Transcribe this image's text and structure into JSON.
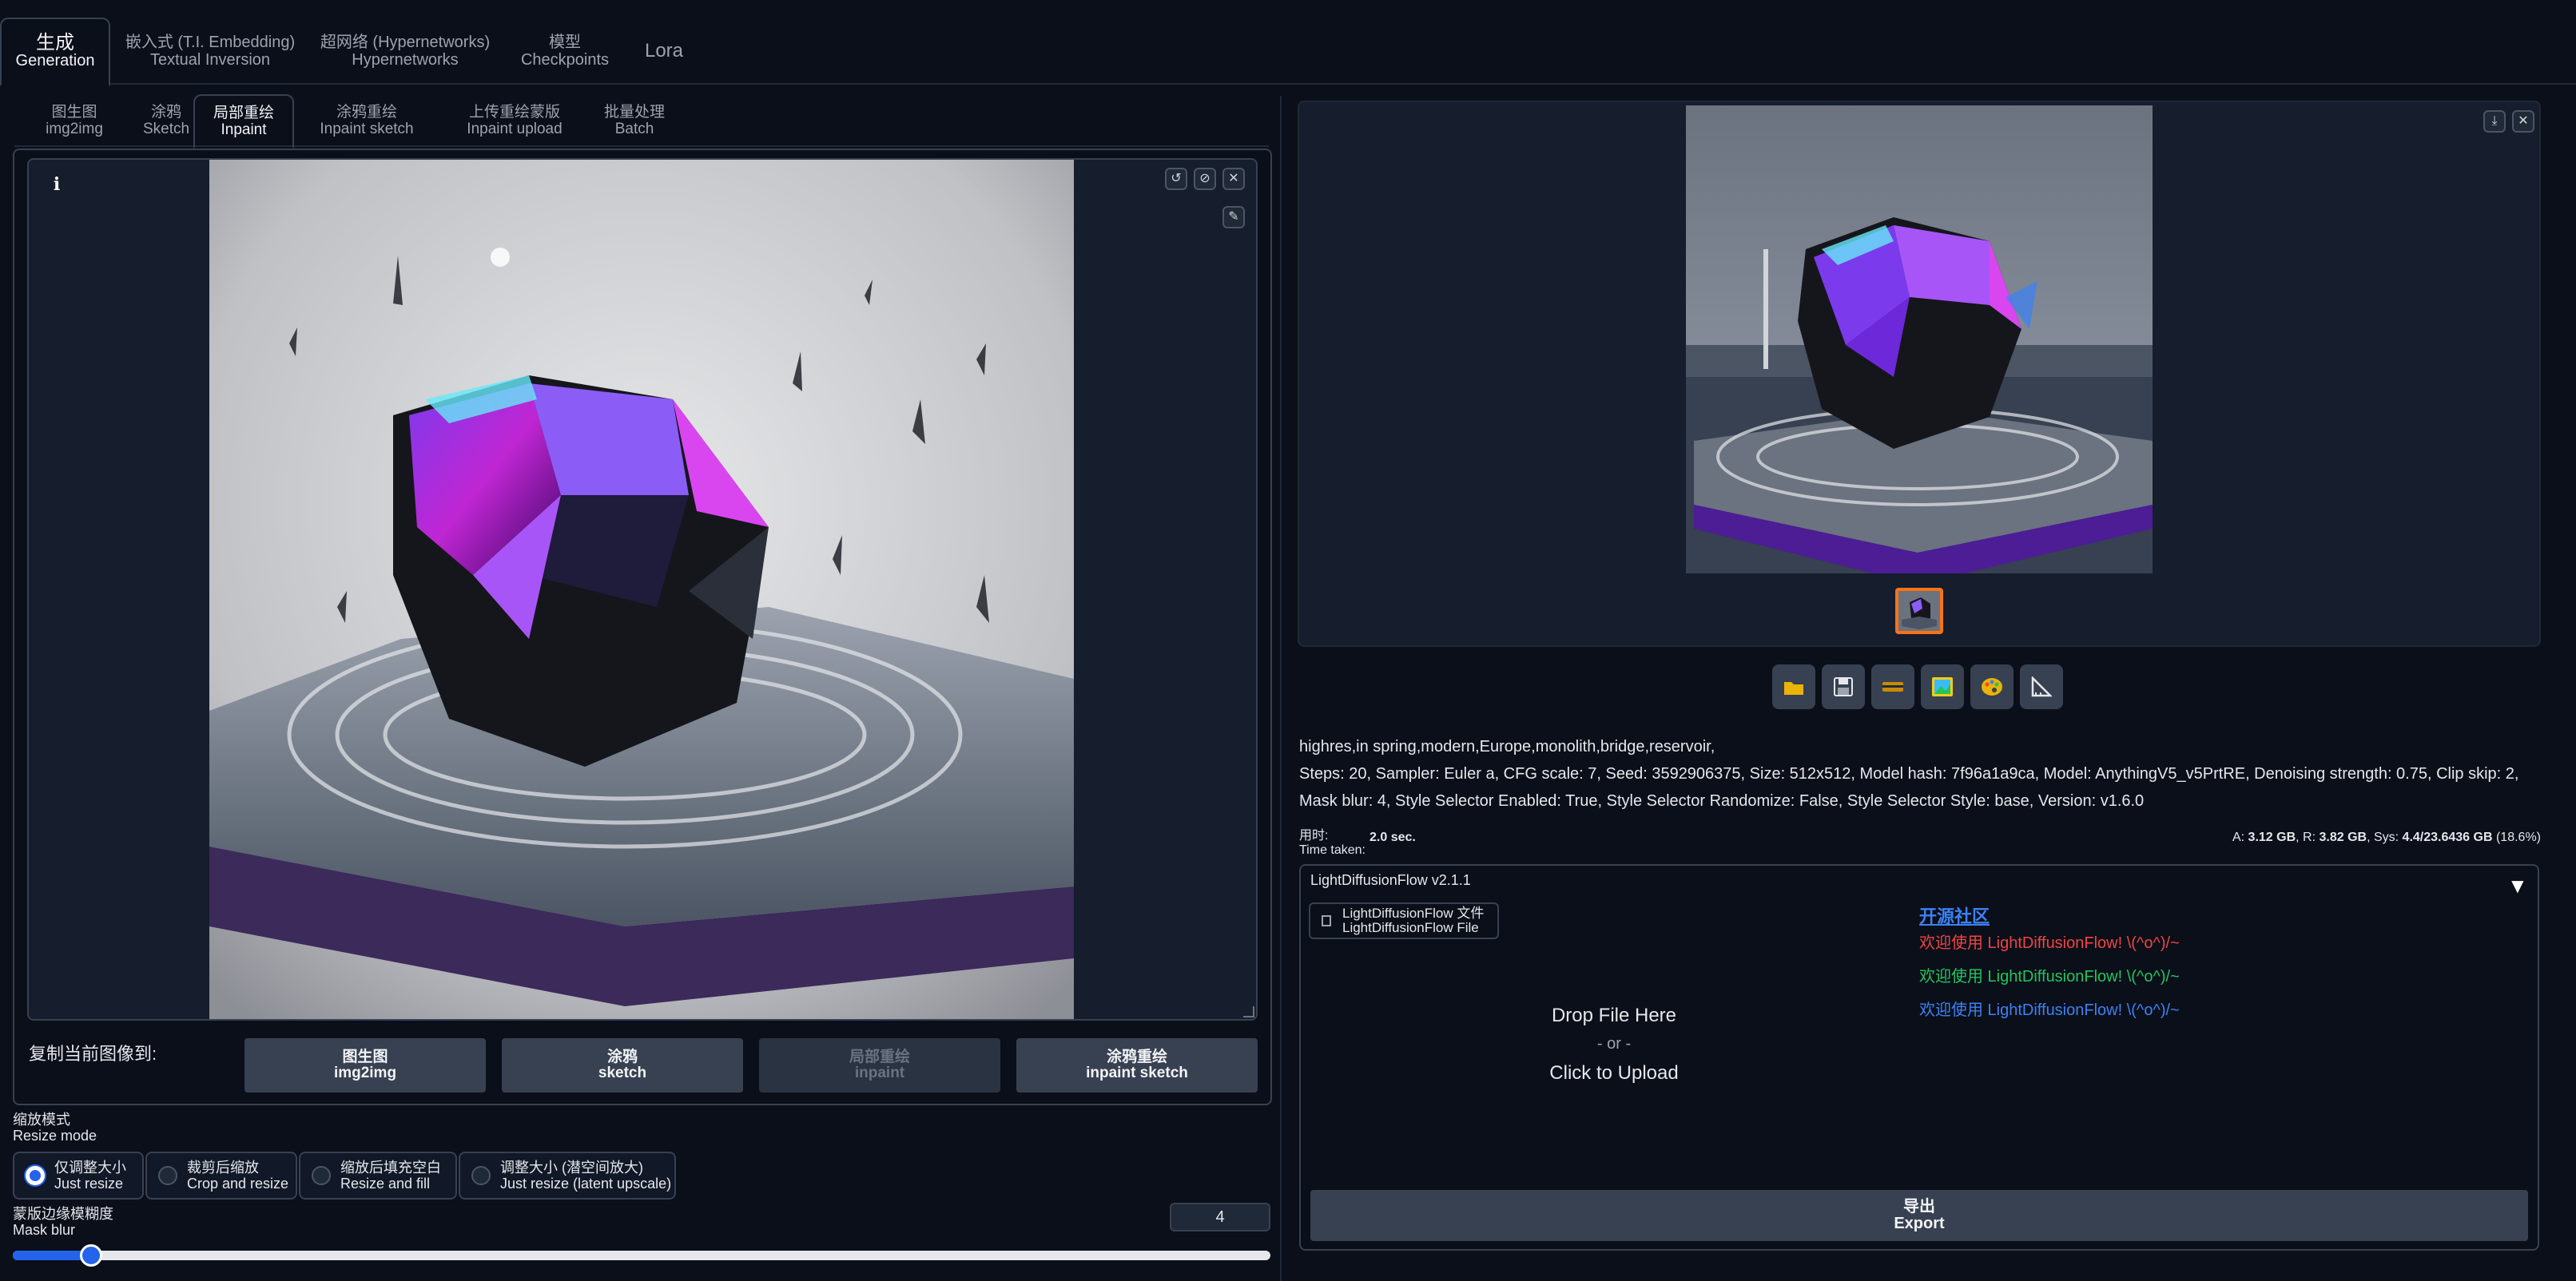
{
  "top_tabs": [
    {
      "cn": "生成",
      "en": "Generation",
      "active": true
    },
    {
      "cn": "嵌入式 (T.I. Embedding)",
      "en": "Textual Inversion"
    },
    {
      "cn": "超网络 (Hypernetworks)",
      "en": "Hypernetworks"
    },
    {
      "cn": "模型",
      "en": "Checkpoints"
    },
    {
      "cn": "Lora",
      "en": ""
    }
  ],
  "sub_tabs": [
    {
      "cn": "图生图",
      "en": "img2img"
    },
    {
      "cn": "涂鸦",
      "en": "Sketch"
    },
    {
      "cn": "局部重绘",
      "en": "Inpaint",
      "active": true
    },
    {
      "cn": "涂鸦重绘",
      "en": "Inpaint sketch"
    },
    {
      "cn": "上传重绘蒙版",
      "en": "Inpaint upload"
    },
    {
      "cn": "批量处理",
      "en": "Batch"
    }
  ],
  "canvas": {
    "info": "i"
  },
  "copy_to": {
    "label": "复制当前图像到:",
    "buttons": [
      {
        "cn": "图生图",
        "en": "img2img"
      },
      {
        "cn": "涂鸦",
        "en": "sketch"
      },
      {
        "cn": "局部重绘",
        "en": "inpaint",
        "disabled": true
      },
      {
        "cn": "涂鸦重绘",
        "en": "inpaint sketch"
      }
    ]
  },
  "resize_mode": {
    "cn": "缩放模式",
    "en": "Resize mode",
    "options": [
      {
        "cn": "仅调整大小",
        "en": "Just resize",
        "checked": true
      },
      {
        "cn": "裁剪后缩放",
        "en": "Crop and resize"
      },
      {
        "cn": "缩放后填充空白",
        "en": "Resize and fill"
      },
      {
        "cn": "调整大小 (潜空间放大)",
        "en": "Just resize (latent upscale)"
      }
    ]
  },
  "mask_blur": {
    "cn": "蒙版边缘模糊度",
    "en": "Mask blur",
    "value": "4",
    "fraction": 0.0625
  },
  "output": {
    "prompt": "highres,in spring,modern,Europe,monolith,bridge,reservoir,",
    "params": "Steps: 20, Sampler: Euler a, CFG scale: 7, Seed: 3592906375, Size: 512x512, Model hash: 7f96a1a9ca, Model: AnythingV5_v5PrtRE, Denoising strength: 0.75, Clip skip: 2, Mask blur: 4, Style Selector Enabled: True, Style Selector Randomize: False, Style Selector Style: base, Version: v1.6.0",
    "time_label_cn": "用时:",
    "time_label_en": "Time taken:",
    "time_value": "2.0 sec.",
    "mem_a_label": "A:",
    "mem_a": "3.12 GB",
    "mem_r_label": "R:",
    "mem_r": "3.82 GB",
    "mem_sys_label": "Sys:",
    "mem_sys": "4.4/23.6436 GB",
    "mem_pct": "(18.6%)"
  },
  "tool_icons": [
    "folder-icon",
    "save-icon",
    "zip-icon",
    "image-icon",
    "palette-icon",
    "ruler-icon"
  ],
  "ldf": {
    "title": "LightDiffusionFlow v2.1.1",
    "arrow": "▼",
    "file_cn": "LightDiffusionFlow 文件",
    "file_en": "LightDiffusionFlow File",
    "drop": "Drop File Here",
    "or": "- or -",
    "click": "Click to Upload",
    "community": "开源社区",
    "welcome": [
      {
        "text": "欢迎使用 LightDiffusionFlow! \\(^o^)/~",
        "color": "#ef4444"
      },
      {
        "text": "欢迎使用 LightDiffusionFlow! \\(^o^)/~",
        "color": "#22c55e"
      },
      {
        "text": "欢迎使用 LightDiffusionFlow! \\(^o^)/~",
        "color": "#3b82f6"
      }
    ],
    "export_cn": "导出",
    "export_en": "Export"
  }
}
